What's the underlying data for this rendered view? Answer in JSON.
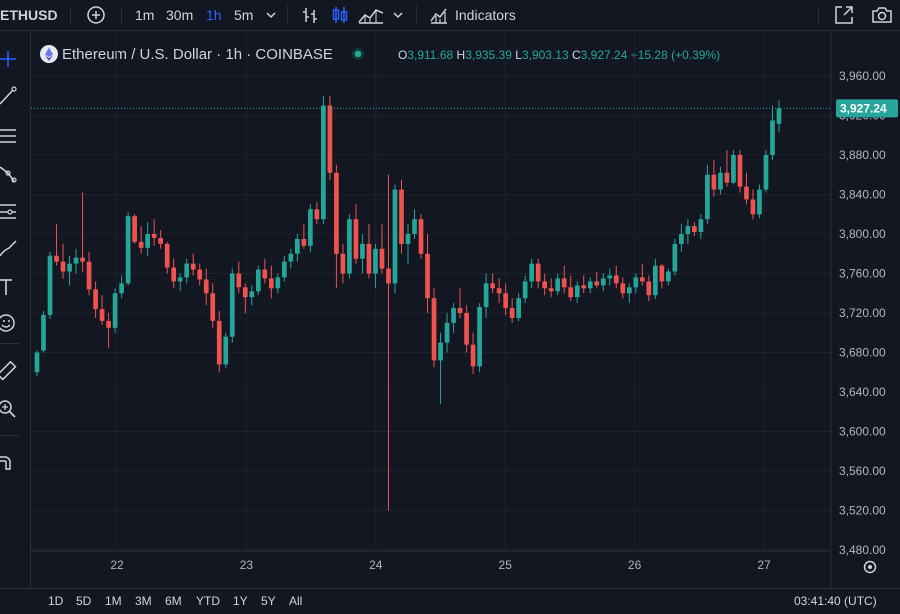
{
  "toolbar": {
    "symbol": "ETHUSD",
    "intervals": [
      "1m",
      "30m",
      "1h",
      "5m"
    ],
    "indicators_label": "Indicators"
  },
  "legend": {
    "title": "Ethereum / U.S. Dollar · 1h · COINBASE",
    "open_label": "O",
    "open": "3,911.68",
    "high_label": "H",
    "high": "3,935.39",
    "low_label": "L",
    "low": "3,903.13",
    "close_label": "C",
    "close": "3,927.24",
    "change": "+15.28 (+0.39%)"
  },
  "bottom": {
    "ranges": [
      "1D",
      "5D",
      "1M",
      "3M",
      "6M",
      "YTD",
      "1Y",
      "5Y",
      "All"
    ],
    "clock": "03:41:40 (UTC)"
  },
  "colors": {
    "up": "#26a69a",
    "down": "#ef5350",
    "background": "#131722",
    "accent": "#2962ff"
  },
  "icons": [
    "plus-circle-icon",
    "chevron-down-icon",
    "bar-chart-icon",
    "candles-icon",
    "area-chart-icon",
    "indicators-icon",
    "fullscreen-icon",
    "camera-icon",
    "crosshair-icon",
    "trend-line-icon",
    "fib-icon",
    "pattern-icon",
    "projection-icon",
    "brush-icon",
    "text-icon",
    "emoji-icon",
    "ruler-icon",
    "zoom-icon",
    "magnet-icon",
    "settings-icon"
  ],
  "chart_data": {
    "type": "candlestick",
    "x_ticks": [
      "22",
      "23",
      "24",
      "25",
      "26",
      "27"
    ],
    "y_ticks": [
      "3,480.00",
      "3,520.00",
      "3,560.00",
      "3,600.00",
      "3,640.00",
      "3,680.00",
      "3,720.00",
      "3,760.00",
      "3,800.00",
      "3,840.00",
      "3,880.00",
      "3,920.00",
      "3,960.00"
    ],
    "ylim": [
      3470,
      3975
    ],
    "last_price": 3927.24,
    "last_price_label": "3,927.24",
    "candles": [
      [
        3660,
        3682,
        3656,
        3680
      ],
      [
        3682,
        3722,
        3680,
        3718
      ],
      [
        3718,
        3782,
        3714,
        3778
      ],
      [
        3778,
        3810,
        3768,
        3772
      ],
      [
        3772,
        3790,
        3755,
        3762
      ],
      [
        3762,
        3778,
        3748,
        3770
      ],
      [
        3770,
        3785,
        3760,
        3776
      ],
      [
        3776,
        3842,
        3762,
        3772
      ],
      [
        3772,
        3782,
        3738,
        3744
      ],
      [
        3744,
        3752,
        3715,
        3724
      ],
      [
        3724,
        3738,
        3708,
        3712
      ],
      [
        3712,
        3720,
        3685,
        3705
      ],
      [
        3705,
        3745,
        3700,
        3740
      ],
      [
        3740,
        3758,
        3735,
        3750
      ],
      [
        3750,
        3822,
        3748,
        3818
      ],
      [
        3818,
        3820,
        3790,
        3792
      ],
      [
        3792,
        3808,
        3780,
        3786
      ],
      [
        3786,
        3812,
        3778,
        3800
      ],
      [
        3800,
        3815,
        3788,
        3796
      ],
      [
        3796,
        3804,
        3785,
        3790
      ],
      [
        3790,
        3792,
        3760,
        3766
      ],
      [
        3766,
        3775,
        3745,
        3752
      ],
      [
        3752,
        3760,
        3742,
        3756
      ],
      [
        3756,
        3775,
        3750,
        3770
      ],
      [
        3770,
        3780,
        3758,
        3764
      ],
      [
        3764,
        3770,
        3748,
        3754
      ],
      [
        3754,
        3765,
        3728,
        3740
      ],
      [
        3740,
        3750,
        3705,
        3712
      ],
      [
        3712,
        3722,
        3660,
        3668
      ],
      [
        3668,
        3700,
        3664,
        3696
      ],
      [
        3696,
        3765,
        3690,
        3760
      ],
      [
        3760,
        3772,
        3740,
        3746
      ],
      [
        3746,
        3750,
        3720,
        3736
      ],
      [
        3736,
        3748,
        3728,
        3742
      ],
      [
        3742,
        3768,
        3738,
        3764
      ],
      [
        3764,
        3775,
        3750,
        3755
      ],
      [
        3755,
        3768,
        3735,
        3745
      ],
      [
        3745,
        3760,
        3740,
        3756
      ],
      [
        3756,
        3778,
        3752,
        3772
      ],
      [
        3772,
        3785,
        3765,
        3780
      ],
      [
        3780,
        3800,
        3772,
        3795
      ],
      [
        3795,
        3810,
        3785,
        3788
      ],
      [
        3788,
        3830,
        3782,
        3825
      ],
      [
        3825,
        3832,
        3810,
        3815
      ],
      [
        3815,
        3940,
        3810,
        3930
      ],
      [
        3930,
        3940,
        3855,
        3862
      ],
      [
        3862,
        3870,
        3745,
        3780
      ],
      [
        3780,
        3790,
        3750,
        3760
      ],
      [
        3760,
        3820,
        3755,
        3815
      ],
      [
        3815,
        3830,
        3770,
        3775
      ],
      [
        3775,
        3800,
        3760,
        3790
      ],
      [
        3790,
        3810,
        3755,
        3760
      ],
      [
        3760,
        3790,
        3745,
        3785
      ],
      [
        3785,
        3810,
        3760,
        3765
      ],
      [
        3765,
        3860,
        3520,
        3750
      ],
      [
        3750,
        3850,
        3740,
        3845
      ],
      [
        3845,
        3855,
        3780,
        3790
      ],
      [
        3790,
        3810,
        3770,
        3800
      ],
      [
        3800,
        3825,
        3795,
        3815
      ],
      [
        3815,
        3820,
        3775,
        3780
      ],
      [
        3780,
        3800,
        3720,
        3735
      ],
      [
        3735,
        3745,
        3665,
        3672
      ],
      [
        3672,
        3700,
        3628,
        3690
      ],
      [
        3690,
        3720,
        3680,
        3710
      ],
      [
        3710,
        3730,
        3700,
        3725
      ],
      [
        3725,
        3745,
        3715,
        3720
      ],
      [
        3720,
        3728,
        3680,
        3688
      ],
      [
        3688,
        3700,
        3658,
        3666
      ],
      [
        3666,
        3730,
        3660,
        3726
      ],
      [
        3726,
        3760,
        3715,
        3750
      ],
      [
        3750,
        3760,
        3740,
        3745
      ],
      [
        3745,
        3755,
        3730,
        3740
      ],
      [
        3740,
        3750,
        3718,
        3725
      ],
      [
        3725,
        3735,
        3710,
        3715
      ],
      [
        3715,
        3740,
        3712,
        3735
      ],
      [
        3735,
        3758,
        3730,
        3752
      ],
      [
        3752,
        3775,
        3745,
        3770
      ],
      [
        3770,
        3775,
        3745,
        3752
      ],
      [
        3752,
        3760,
        3738,
        3745
      ],
      [
        3745,
        3755,
        3736,
        3742
      ],
      [
        3742,
        3760,
        3738,
        3755
      ],
      [
        3755,
        3768,
        3740,
        3746
      ],
      [
        3746,
        3758,
        3732,
        3736
      ],
      [
        3736,
        3752,
        3730,
        3748
      ],
      [
        3748,
        3758,
        3740,
        3745
      ],
      [
        3745,
        3756,
        3740,
        3752
      ],
      [
        3752,
        3762,
        3745,
        3748
      ],
      [
        3748,
        3760,
        3742,
        3755
      ],
      [
        3755,
        3765,
        3748,
        3758
      ],
      [
        3758,
        3768,
        3745,
        3750
      ],
      [
        3750,
        3756,
        3735,
        3740
      ],
      [
        3740,
        3750,
        3730,
        3746
      ],
      [
        3746,
        3760,
        3740,
        3756
      ],
      [
        3756,
        3770,
        3748,
        3752
      ],
      [
        3752,
        3758,
        3732,
        3738
      ],
      [
        3738,
        3775,
        3734,
        3768
      ],
      [
        3768,
        3770,
        3745,
        3752
      ],
      [
        3752,
        3765,
        3748,
        3762
      ],
      [
        3762,
        3795,
        3758,
        3790
      ],
      [
        3790,
        3810,
        3782,
        3800
      ],
      [
        3800,
        3815,
        3790,
        3808
      ],
      [
        3808,
        3812,
        3798,
        3802
      ],
      [
        3802,
        3820,
        3795,
        3815
      ],
      [
        3815,
        3870,
        3810,
        3860
      ],
      [
        3860,
        3875,
        3838,
        3845
      ],
      [
        3845,
        3868,
        3840,
        3862
      ],
      [
        3862,
        3885,
        3848,
        3852
      ],
      [
        3852,
        3885,
        3850,
        3880
      ],
      [
        3880,
        3885,
        3842,
        3848
      ],
      [
        3848,
        3862,
        3830,
        3835
      ],
      [
        3835,
        3845,
        3815,
        3820
      ],
      [
        3820,
        3850,
        3816,
        3845
      ],
      [
        3845,
        3885,
        3842,
        3880
      ],
      [
        3880,
        3930,
        3875,
        3915
      ],
      [
        3911.68,
        3935.39,
        3903.13,
        3927.24
      ]
    ]
  }
}
